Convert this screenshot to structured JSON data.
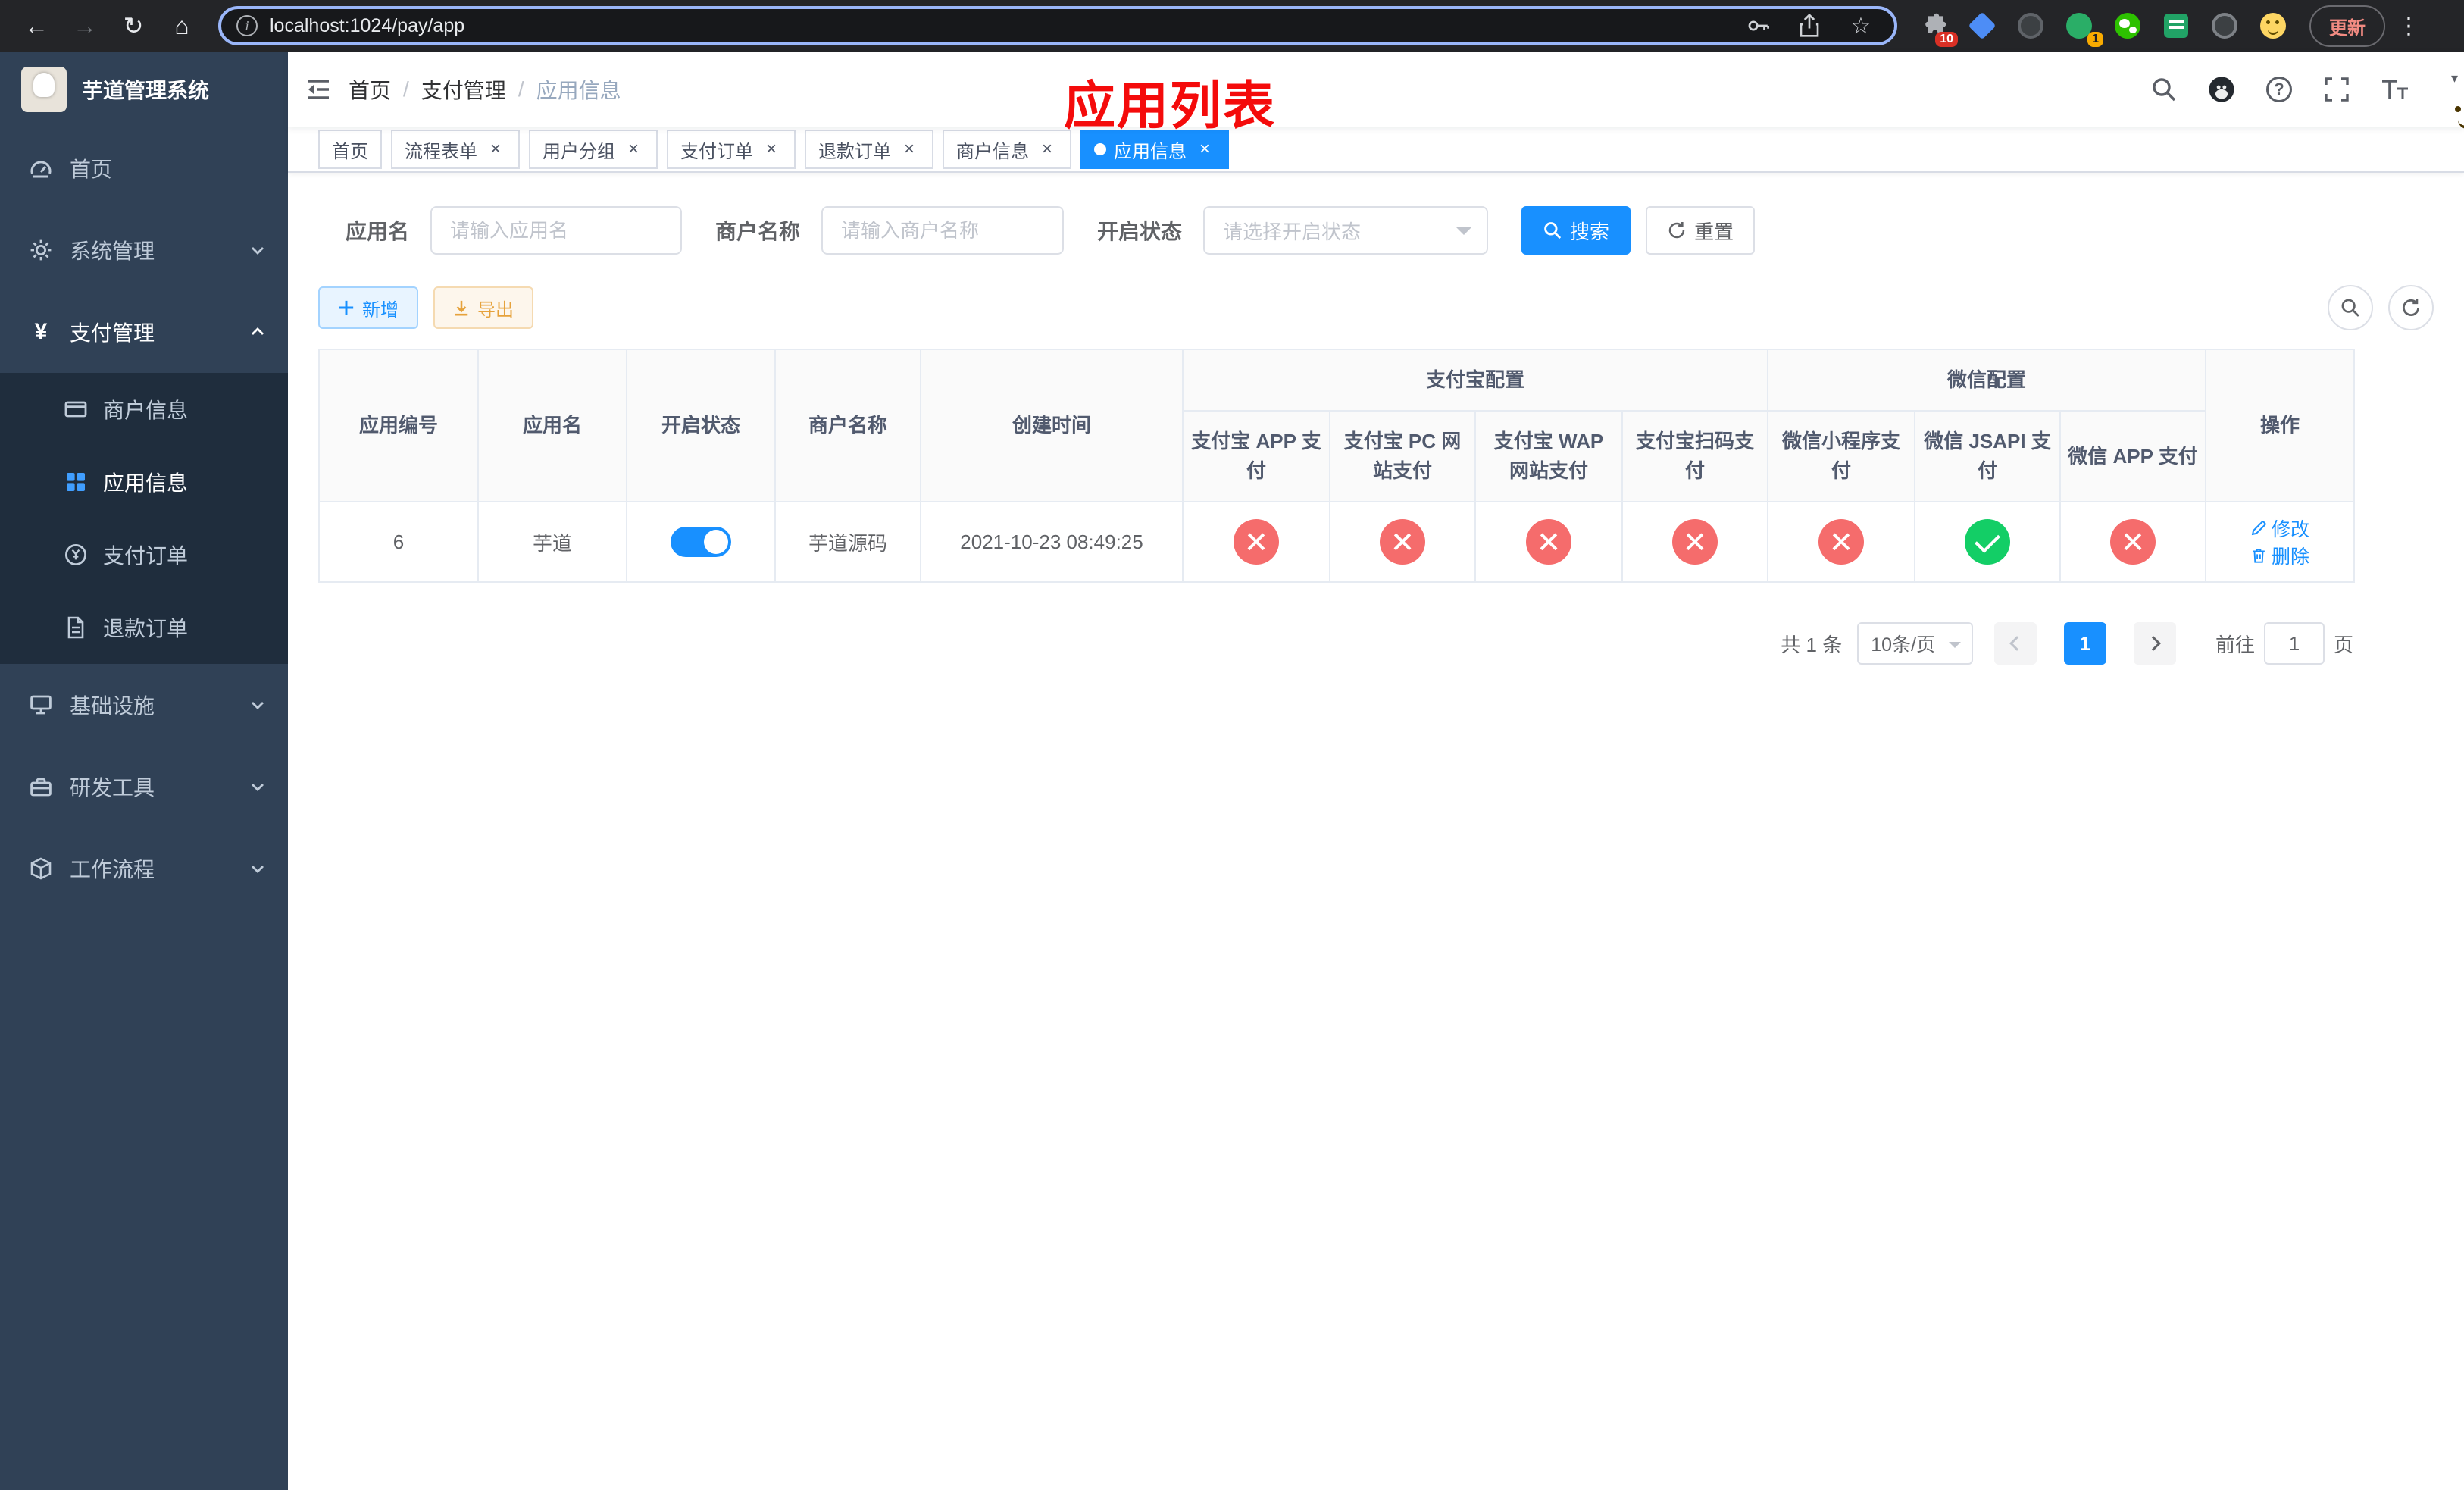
{
  "icons": {
    "back": "←",
    "forward": "→",
    "reload": "↻",
    "home": "⌂",
    "star": "☆",
    "overflow": "⋮",
    "yen": "¥",
    "close": "×",
    "help": "?",
    "caret": "▾",
    "info": "i"
  },
  "browser": {
    "url": "localhost:1024/pay/app",
    "update_label": "更新",
    "extension_badge_puzzle": "10",
    "extension_badge_green": "1"
  },
  "annotation": {
    "title": "应用列表"
  },
  "sidebar": {
    "app_title": "芋道管理系统",
    "items": [
      {
        "label": "首页"
      },
      {
        "label": "系统管理"
      },
      {
        "label": "支付管理"
      },
      {
        "label": "基础设施"
      },
      {
        "label": "研发工具"
      },
      {
        "label": "工作流程"
      }
    ],
    "payment_submenu": [
      {
        "label": "商户信息"
      },
      {
        "label": "应用信息"
      },
      {
        "label": "支付订单"
      },
      {
        "label": "退款订单"
      }
    ]
  },
  "breadcrumb": {
    "separator": "/",
    "items": [
      {
        "label": "首页"
      },
      {
        "label": "支付管理"
      },
      {
        "label": "应用信息"
      }
    ]
  },
  "tabbar": {
    "tabs": [
      {
        "label": "首页"
      },
      {
        "label": "流程表单"
      },
      {
        "label": "用户分组"
      },
      {
        "label": "支付订单"
      },
      {
        "label": "退款订单"
      },
      {
        "label": "商户信息"
      },
      {
        "label": "应用信息"
      }
    ]
  },
  "filters": {
    "app_name_label": "应用名",
    "app_name_placeholder": "请输入应用名",
    "merchant_label": "商户名称",
    "merchant_placeholder": "请输入商户名称",
    "status_label": "开启状态",
    "status_placeholder": "请选择开启状态",
    "search_label": "搜索",
    "reset_label": "重置"
  },
  "toolbar": {
    "add_label": "新增",
    "export_label": "导出"
  },
  "table": {
    "group_alipay": "支付宝配置",
    "group_wechat": "微信配置",
    "columns": [
      "应用编号",
      "应用名",
      "开启状态",
      "商户名称",
      "创建时间",
      "支付宝 APP 支付",
      "支付宝 PC 网站支付",
      "支付宝 WAP 网站支付",
      "支付宝扫码支付",
      "微信小程序支付",
      "微信 JSAPI 支付",
      "微信 APP 支付",
      "操作"
    ],
    "row": {
      "id": "6",
      "name": "芋道",
      "switch": "on",
      "merchant": "芋道源码",
      "created": "2021-10-23 08:49:25",
      "configs": [
        "no",
        "no",
        "no",
        "no",
        "no",
        "yes",
        "no"
      ],
      "edit_label": "修改",
      "delete_label": "删除"
    }
  },
  "pagination": {
    "total": "共 1 条",
    "page_size": "10条/页",
    "page": "1",
    "goto_label": "前往",
    "goto_value": "1",
    "unit_label": "页"
  },
  "colors": {
    "accent": "#1890ff",
    "danger": "#f56c6c",
    "success": "#13ce66",
    "sidebar": "#304156",
    "annotation": "#f40b0b"
  }
}
